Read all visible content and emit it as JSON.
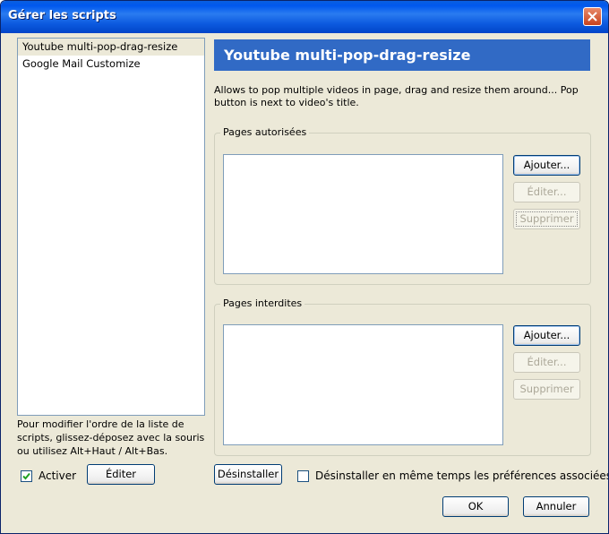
{
  "window": {
    "title": "Gérer les scripts"
  },
  "scripts_list": {
    "items": [
      {
        "label": "Youtube multi-pop-drag-resize",
        "selected": true
      },
      {
        "label": "Google Mail Customize",
        "selected": false
      }
    ]
  },
  "sidebar": {
    "help_text": "Pour modifier l'ordre de la liste de scripts, glissez-déposez avec la souris ou utilisez Alt+Haut / Alt+Bas.",
    "activate_label": "Activer",
    "activate_checked": true,
    "edit_label": "Éditer"
  },
  "detail": {
    "title": "Youtube multi-pop-drag-resize",
    "description": "Allows to pop multiple videos in page, drag and resize them around... Pop button is next to video's title."
  },
  "included_pages": {
    "legend": "Pages autorisées",
    "add_label": "Ajouter...",
    "edit_label": "Éditer...",
    "remove_label": "Supprimer"
  },
  "excluded_pages": {
    "legend": "Pages interdites",
    "add_label": "Ajouter...",
    "edit_label": "Éditer...",
    "remove_label": "Supprimer"
  },
  "uninstall": {
    "button_label": "Désinstaller",
    "prefs_label": "Désinstaller en même temps les préférences associées",
    "prefs_checked": false
  },
  "footer": {
    "ok_label": "OK",
    "cancel_label": "Annuler"
  },
  "colors": {
    "title_bar": "#0058ee",
    "header_banner": "#316ac5",
    "window_background": "#ece9d8"
  }
}
